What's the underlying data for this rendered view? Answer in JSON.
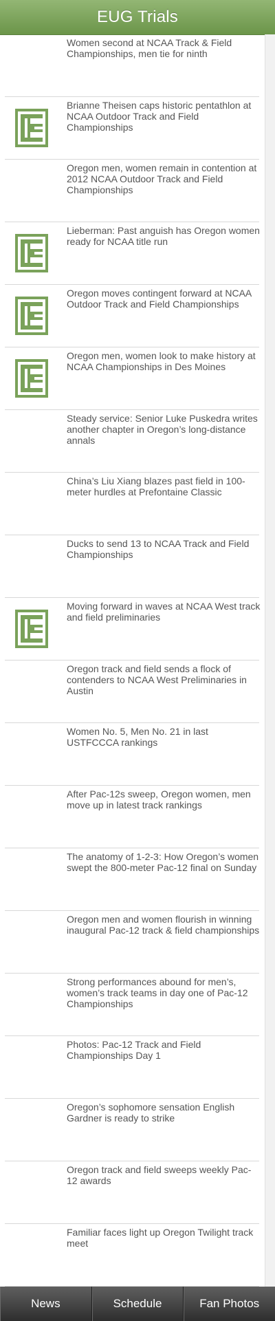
{
  "header": {
    "title": "EUG Trials"
  },
  "colors": {
    "accent": "#6b9549",
    "logo": "#7aa25a"
  },
  "articles": [
    {
      "headline": "Women second at NCAA Track & Field Championships, men tie for ninth",
      "thumb": false
    },
    {
      "headline": "Brianne Theisen caps historic pentathlon at NCAA Outdoor Track and Field Championships",
      "thumb": true
    },
    {
      "headline": "Oregon men, women remain in contention at 2012 NCAA Outdoor Track and Field Championships",
      "thumb": false
    },
    {
      "headline": "Lieberman: Past anguish has Oregon women ready for NCAA title run",
      "thumb": true
    },
    {
      "headline": "Oregon moves contingent forward at NCAA Outdoor Track and Field Championships",
      "thumb": true
    },
    {
      "headline": "Oregon men, women look to make history at NCAA Championships in Des Moines",
      "thumb": true
    },
    {
      "headline": "Steady service: Senior Luke Puskedra writes another chapter in Oregon’s long-distance annals",
      "thumb": false
    },
    {
      "headline": "China’s Liu Xiang blazes past field in 100-meter hurdles at Prefontaine Classic",
      "thumb": false
    },
    {
      "headline": "Ducks to send 13 to NCAA Track and Field Championships",
      "thumb": false
    },
    {
      "headline": "Moving forward in waves at NCAA West track and field preliminaries",
      "thumb": true
    },
    {
      "headline": "Oregon track and field sends a flock of contenders to NCAA West Preliminaries in Austin",
      "thumb": false
    },
    {
      "headline": "Women No. 5, Men No. 21 in last USTFCCCA rankings",
      "thumb": false
    },
    {
      "headline": "After Pac-12s sweep, Oregon women, men move up in latest track rankings",
      "thumb": false
    },
    {
      "headline": "The anatomy of 1-2-3: How Oregon’s women swept the 800-meter Pac-12 final on Sunday",
      "thumb": false
    },
    {
      "headline": "Oregon men and women flourish in winning inaugural Pac-12 track & field championships",
      "thumb": false
    },
    {
      "headline": "Strong performances abound for men’s, women’s track teams in day one of Pac-12 Championships",
      "thumb": false
    },
    {
      "headline": "Photos: Pac-12 Track and Field Championships Day 1",
      "thumb": false
    },
    {
      "headline": "Oregon’s sophomore sensation English Gardner is ready to strike",
      "thumb": false
    },
    {
      "headline": "Oregon track and field sweeps weekly Pac-12 awards",
      "thumb": false
    },
    {
      "headline": "Familiar faces light up Oregon Twilight track meet",
      "thumb": false
    }
  ],
  "tabs": [
    {
      "label": "News"
    },
    {
      "label": "Schedule"
    },
    {
      "label": "Fan Photos"
    }
  ]
}
